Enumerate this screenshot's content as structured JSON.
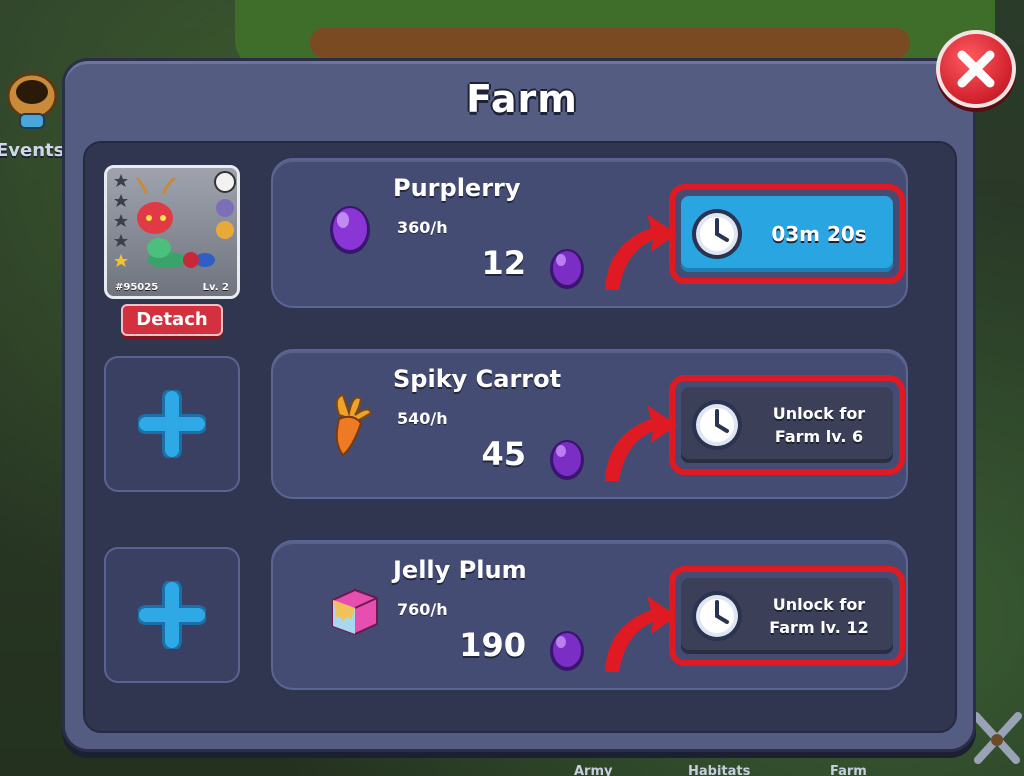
{
  "background": {
    "events_label": "Events",
    "bottom_tabs": [
      "Army",
      "Habitats",
      "Farm"
    ]
  },
  "modal": {
    "title": "Farm"
  },
  "pet_slot": {
    "id": "#95025",
    "level": "Lv. 2",
    "detach_label": "Detach"
  },
  "crops": [
    {
      "name": "Purplerry",
      "rate": "360/h",
      "price": "12",
      "action": "03m 20s",
      "action_type": "timer",
      "icon": "purple-berry-icon"
    },
    {
      "name": "Spiky Carrot",
      "rate": "540/h",
      "price": "45",
      "action_line1": "Unlock for",
      "action_line2": "Farm lv. 6",
      "action_type": "locked",
      "icon": "carrot-icon"
    },
    {
      "name": "Jelly Plum",
      "rate": "760/h",
      "price": "190",
      "action_line1": "Unlock for",
      "action_line2": "Farm lv. 12",
      "action_type": "locked",
      "icon": "jelly-cube-icon"
    }
  ],
  "colors": {
    "modal_bg": "#545c82",
    "panel_bg": "#454c73",
    "timer_blue": "#29a6e2",
    "highlight_red": "#e01a22",
    "detach_red": "#d4313f",
    "gem_purple": "#7b2ec4"
  }
}
